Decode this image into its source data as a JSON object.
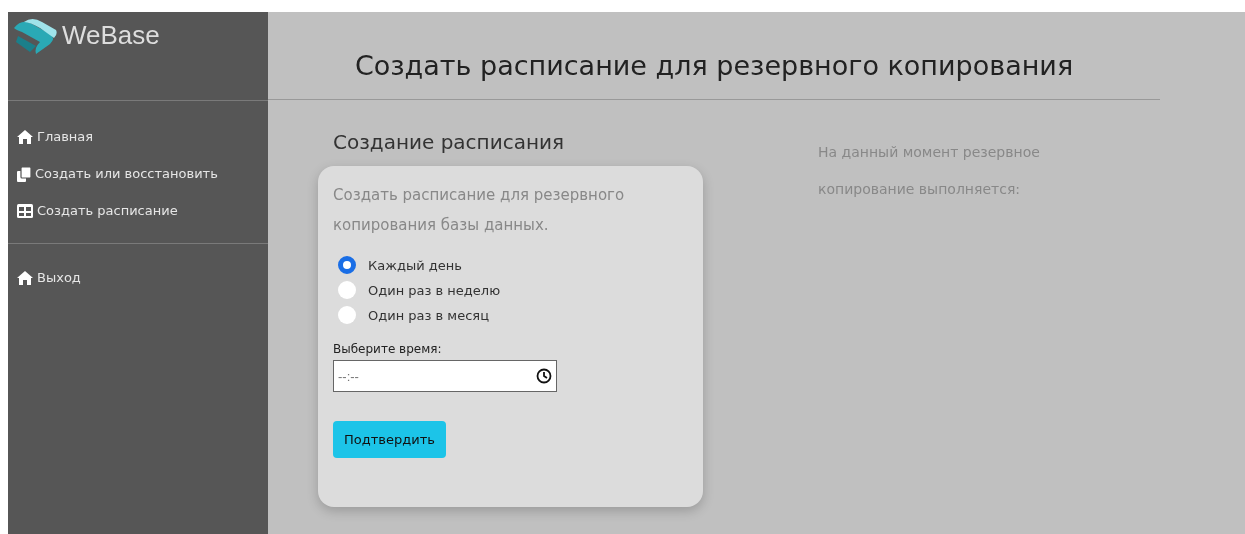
{
  "brand": "WeBase",
  "sidebar": {
    "items": [
      {
        "label": "Главная",
        "kind": "home"
      },
      {
        "label": "Создать или восстановить",
        "kind": "copy"
      },
      {
        "label": "Создать расписание",
        "kind": "table"
      }
    ],
    "bottom_items": [
      {
        "label": "Выход",
        "kind": "home"
      }
    ]
  },
  "page_title": "Создать расписание для резервного копирования",
  "form": {
    "heading": "Создание расписания",
    "description": "Создать расписание для резервного копирования базы данных.",
    "options": [
      {
        "label": "Каждый день",
        "selected": true
      },
      {
        "label": "Один раз в неделю",
        "selected": false
      },
      {
        "label": "Один раз в месяц",
        "selected": false
      }
    ],
    "time_label": "Выберите время:",
    "time_placeholder": "--:--",
    "submit": "Подтвердить"
  },
  "status_text": "На данный момент резервное копирование выполняется:"
}
